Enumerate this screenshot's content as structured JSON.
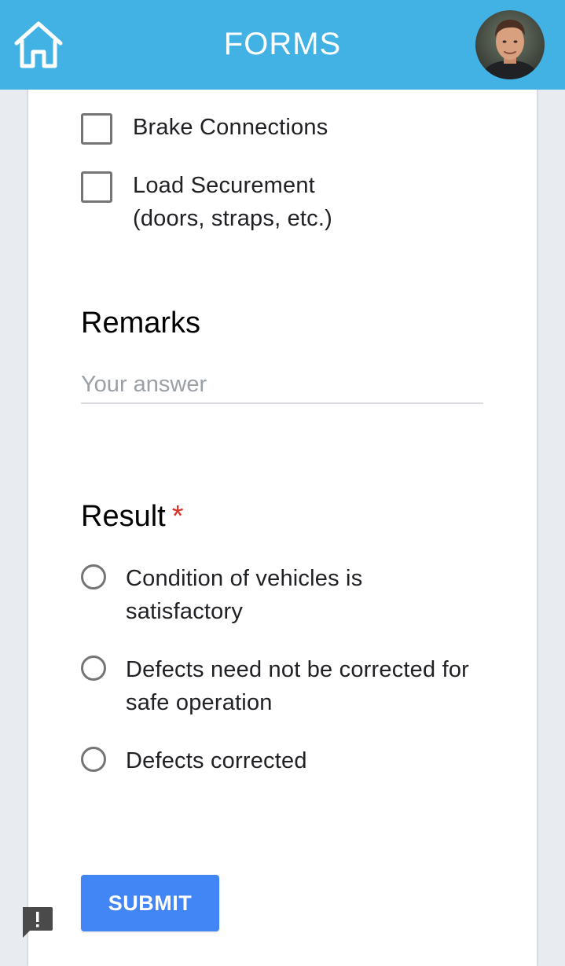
{
  "header": {
    "title": "FORMS",
    "background_color": "#42b1e4"
  },
  "checklist": {
    "items": [
      {
        "label": "Brake Connections",
        "checked": false
      },
      {
        "label": "Load Securement (doors, straps, etc.)",
        "checked": false
      }
    ]
  },
  "remarks": {
    "title": "Remarks",
    "placeholder": "Your answer",
    "value": ""
  },
  "result": {
    "title": "Result",
    "required_marker": "*",
    "options": [
      {
        "label": "Condition of vehicles is satisfactory",
        "selected": false
      },
      {
        "label": "Defects need not be corrected for safe operation",
        "selected": false
      },
      {
        "label": "Defects corrected",
        "selected": false
      }
    ]
  },
  "submit": {
    "label": "SUBMIT",
    "color": "#4285f4"
  },
  "icons": {
    "home": "home-icon",
    "avatar": "avatar",
    "feedback": "feedback-icon"
  }
}
